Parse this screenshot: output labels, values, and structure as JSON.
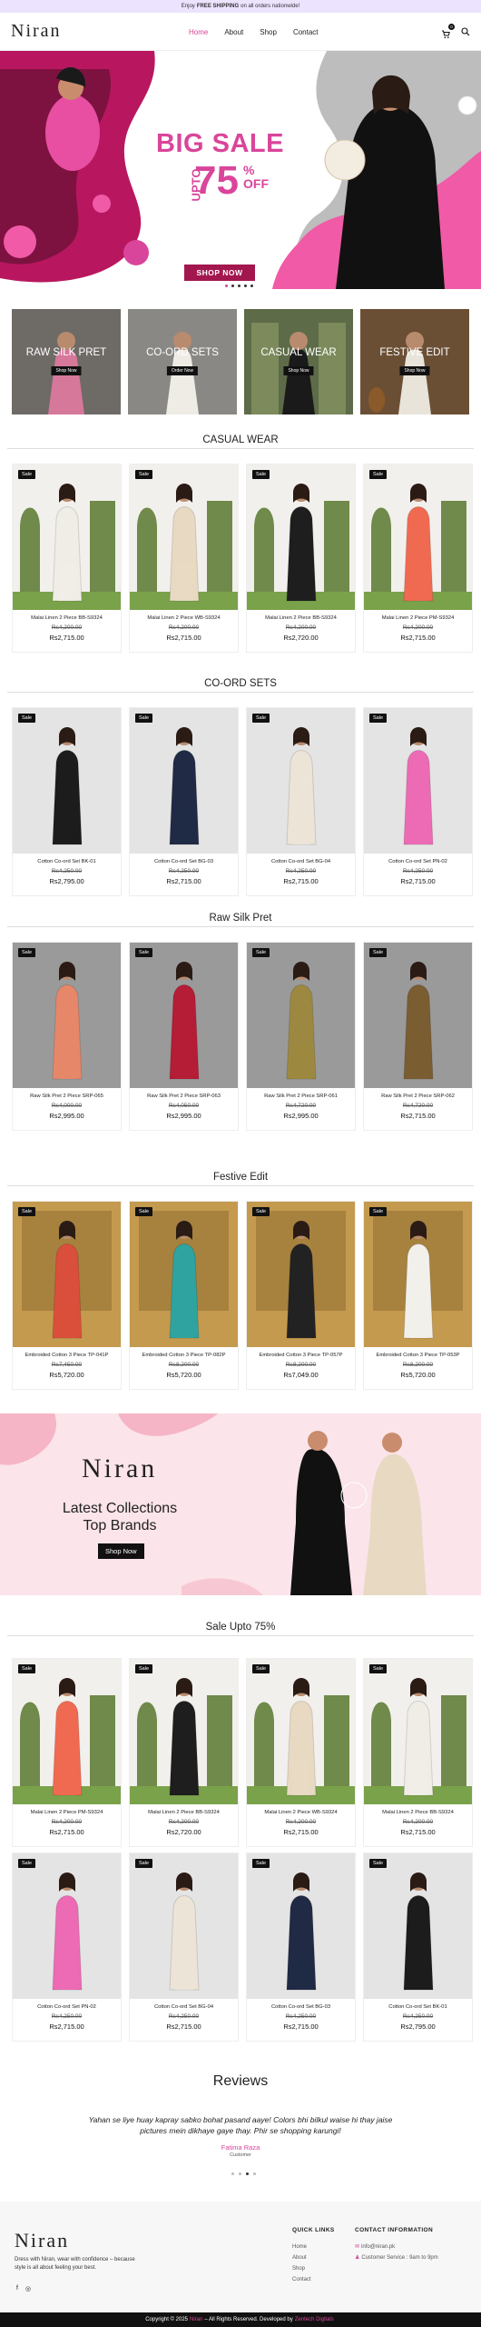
{
  "topbar": {
    "pre": "Enjoy",
    "bold": "FREE SHIPPING",
    "post": "on all orders nationwide!"
  },
  "header": {
    "logo": "Niran",
    "nav": [
      "Home",
      "About",
      "Shop",
      "Contact"
    ],
    "cart_count": "0"
  },
  "hero": {
    "title": "BIG SALE",
    "upto": "UPTO",
    "number": "75",
    "pct": "%",
    "off": "OFF",
    "button": "SHOP NOW"
  },
  "categories": [
    {
      "title": "RAW SILK PRET",
      "button": "Shop Now"
    },
    {
      "title": "CO-ORD SETS",
      "button": "Order Now"
    },
    {
      "title": "CASUAL WEAR",
      "button": "Shop Now"
    },
    {
      "title": "FESTIVE EDIT",
      "button": "Shop Now"
    }
  ],
  "sections": [
    {
      "title": "CASUAL WEAR",
      "products": [
        {
          "badge": "Sale",
          "name": "Malai Linen 2 Piece BB-S9324",
          "old": "Rs4,200.00",
          "new": "Rs2,715.00",
          "color": "#f0ede6"
        },
        {
          "badge": "Sale",
          "name": "Malai Linen 2 Piece WB-S9324",
          "old": "Rs4,200.00",
          "new": "Rs2,715.00",
          "color": "#e8d9c3"
        },
        {
          "badge": "Sale",
          "name": "Malai Linen 2 Piece BB-S9324",
          "old": "Rs4,200.00",
          "new": "Rs2,720.00",
          "color": "#1e1e1e"
        },
        {
          "badge": "Sale",
          "name": "Malai Linen 2 Piece PM-S9324",
          "old": "Rs4,200.00",
          "new": "Rs2,715.00",
          "color": "#f06a52"
        }
      ]
    },
    {
      "title": "CO-ORD SETS",
      "products": [
        {
          "badge": "Sale",
          "name": "Cotton Co-ord Set BK-01",
          "old": "Rs4,250.00",
          "new": "Rs2,795.00",
          "color": "#1c1c1c"
        },
        {
          "badge": "Sale",
          "name": "Cotton Co-ord Set BG-03",
          "old": "Rs4,250.00",
          "new": "Rs2,715.00",
          "color": "#202a45"
        },
        {
          "badge": "Sale",
          "name": "Cotton Co-ord Set BG-04",
          "old": "Rs4,250.00",
          "new": "Rs2,715.00",
          "color": "#ece4d6"
        },
        {
          "badge": "Sale",
          "name": "Cotton Co-ord Set PN-02",
          "old": "Rs4,250.00",
          "new": "Rs2,715.00",
          "color": "#ec6bb4"
        }
      ]
    },
    {
      "title": "Raw Silk Pret",
      "products": [
        {
          "badge": "Sale",
          "name": "Raw Silk Pret 2 Piece SRP-065",
          "old": "Rs4,000.00",
          "new": "Rs2,995.00",
          "color": "#e6876a"
        },
        {
          "badge": "Sale",
          "name": "Raw Silk Pret 2 Piece SRP-063",
          "old": "Rs4,050.00",
          "new": "Rs2,995.00",
          "color": "#b51c35"
        },
        {
          "badge": "Sale",
          "name": "Raw Silk Pret 2 Piece SRP-061",
          "old": "Rs4,720.00",
          "new": "Rs2,995.00",
          "color": "#9c8840"
        },
        {
          "badge": "Sale",
          "name": "Raw Silk Pret 2 Piece SRP-062",
          "old": "Rs4,720.00",
          "new": "Rs2,715.00",
          "color": "#7a5d30"
        }
      ]
    },
    {
      "title": "Festive Edit",
      "products": [
        {
          "badge": "Sale",
          "name": "Embroided Cotton 3 Piece TP-041P",
          "old": "Rs7,450.00",
          "new": "Rs5,720.00",
          "color": "#d94f3b"
        },
        {
          "badge": "Sale",
          "name": "Embroided Cotton 3 Piece TP-082P",
          "old": "Rs8,200.00",
          "new": "Rs5,720.00",
          "color": "#2fa3a0"
        },
        {
          "badge": "Sale",
          "name": "Embroided Cotton 3 Piece TP-057P",
          "old": "Rs8,200.00",
          "new": "Rs7,049.00",
          "color": "#222222"
        },
        {
          "badge": "Sale",
          "name": "Embroided Cotton 3 Piece TP-053P",
          "old": "Rs8,200.00",
          "new": "Rs5,720.00",
          "color": "#f2f0ea"
        }
      ]
    },
    {
      "title": "Sale Upto 75%",
      "products": [
        {
          "badge": "Sale",
          "name": "Malai Linen 2 Piece PM-S9324",
          "old": "Rs4,200.00",
          "new": "Rs2,715.00",
          "color": "#f06a52"
        },
        {
          "badge": "Sale",
          "name": "Malai Linen 2 Piece BB-S9324",
          "old": "Rs4,200.00",
          "new": "Rs2,720.00",
          "color": "#1e1e1e"
        },
        {
          "badge": "Sale",
          "name": "Malai Linen 2 Piece WB-S9324",
          "old": "Rs4,200.00",
          "new": "Rs2,715.00",
          "color": "#e8d9c3"
        },
        {
          "badge": "Sale",
          "name": "Malai Linen 2 Piece BB-S9324",
          "old": "Rs4,200.00",
          "new": "Rs2,715.00",
          "color": "#f0ede6"
        }
      ]
    },
    {
      "title": "",
      "products": [
        {
          "badge": "Sale",
          "name": "Cotton Co-ord Set PN-02",
          "old": "Rs4,250.00",
          "new": "Rs2,715.00",
          "color": "#ec6bb4"
        },
        {
          "badge": "Sale",
          "name": "Cotton Co-ord Set BG-04",
          "old": "Rs4,250.00",
          "new": "Rs2,715.00",
          "color": "#ece4d6"
        },
        {
          "badge": "Sale",
          "name": "Cotton Co-ord Set BG-03",
          "old": "Rs4,250.00",
          "new": "Rs2,715.00",
          "color": "#202a45"
        },
        {
          "badge": "Sale",
          "name": "Cotton Co-ord Set BK-01",
          "old": "Rs4,250.00",
          "new": "Rs2,795.00",
          "color": "#1c1c1c"
        }
      ]
    }
  ],
  "promo": {
    "logo": "Niran",
    "title": "Latest Collections Top Brands",
    "button": "Shop Now"
  },
  "reviews": {
    "title": "Reviews",
    "text": "Yahan se liye huay kapray sabko bohat pasand aaye! Colors bhi bilkul waise hi thay jaise pictures mein dikhaye gaye thay. Phir se shopping karungi!",
    "author": "Fatima Raza",
    "role": "Customer"
  },
  "footer": {
    "logo": "Niran",
    "tagline": "Dress with Niran, wear with confidence – because style is all about feeling your best.",
    "quick_title": "QUICK LINKS",
    "links": [
      "Home",
      "About",
      "Shop",
      "Contact"
    ],
    "contact_title": "CONTACT INFORMATION",
    "email": "info@niran.pk",
    "service": "Customer Service : 9am to 9pm",
    "copyright_pre": "Copyright © 2025",
    "brand": "Niran",
    "copyright_mid": "– All Rights Reserved. Developed by",
    "dev": "Zentech Digitals"
  },
  "colors": {
    "accent": "#d9459a",
    "hero_button": "#a3174f",
    "topbar": "#ece3ff",
    "promo_bg": "#fbe4ea"
  }
}
